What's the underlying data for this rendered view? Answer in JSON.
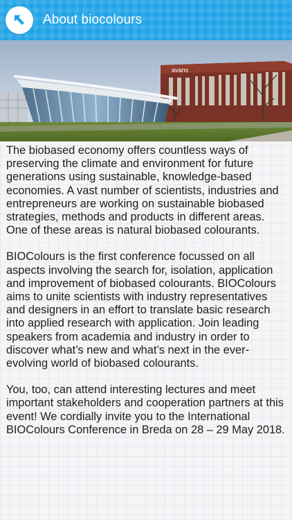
{
  "header": {
    "title": "About biocolours",
    "back_icon": "arrow-up-left-icon",
    "color": "#1fa3e6"
  },
  "hero": {
    "building_sign": "avans"
  },
  "body": {
    "paragraphs": [
      "The biobased economy offers countless ways of preserving the climate and environment for future generations using sustainable, knowledge-based economies. A vast number of scientists, industries and entrepreneurs are working on sustainable biobased strategies, methods and products in different areas. One of these areas is natural biobased colourants.",
      "BIOColours is the first conference focussed on all aspects involving the search for, isolation, application and improvement of biobased colourants. BIOColours aims to unite scientists with industry representatives and designers in an effort to translate basic research into applied research with application. Join leading speakers from academia and industry in order to discover what’s new and what’s next in the ever-evolving world of biobased colourants.",
      "You, too, can attend interesting lectures and meet important stakeholders and cooperation partners at this event! We cordially invite you to the International BIOColours Conference in Breda on 28 – 29 May 2018."
    ]
  }
}
